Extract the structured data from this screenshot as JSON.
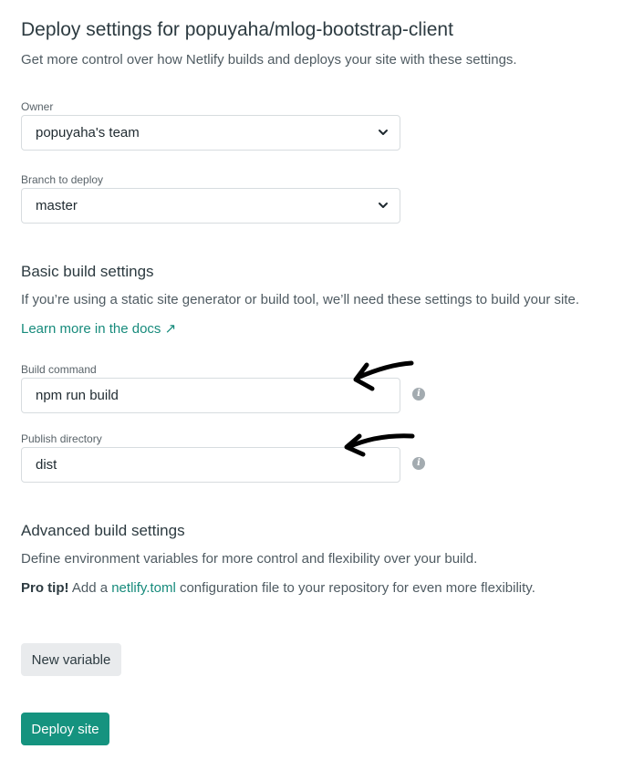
{
  "page": {
    "title": "Deploy settings for popuyaha/mlog-bootstrap-client",
    "subtitle": "Get more control over how Netlify builds and deploys your site with these settings."
  },
  "owner": {
    "label": "Owner",
    "value": "popuyaha's team"
  },
  "branch": {
    "label": "Branch to deploy",
    "value": "master"
  },
  "basic_build": {
    "heading": "Basic build settings",
    "description": "If you’re using a static site generator or build tool, we’ll need these settings to build your site.",
    "docs_link": "Learn more in the docs ↗"
  },
  "build_command": {
    "label": "Build command",
    "value": "npm run build",
    "info_icon": "info-icon"
  },
  "publish_directory": {
    "label": "Publish directory",
    "value": "dist",
    "info_icon": "info-icon"
  },
  "advanced_build": {
    "heading": "Advanced build settings",
    "description": "Define environment variables for more control and flexibility over your build.",
    "pro_tip_strong": "Pro tip!",
    "pro_tip_before": "Add a",
    "pro_tip_link": "netlify.toml",
    "pro_tip_after": "configuration file to your repository for even more flexibility."
  },
  "buttons": {
    "new_variable": "New variable",
    "deploy_site": "Deploy site"
  },
  "colors": {
    "primary": "#15937f",
    "link": "#178b7c",
    "annotation": "#000000"
  }
}
